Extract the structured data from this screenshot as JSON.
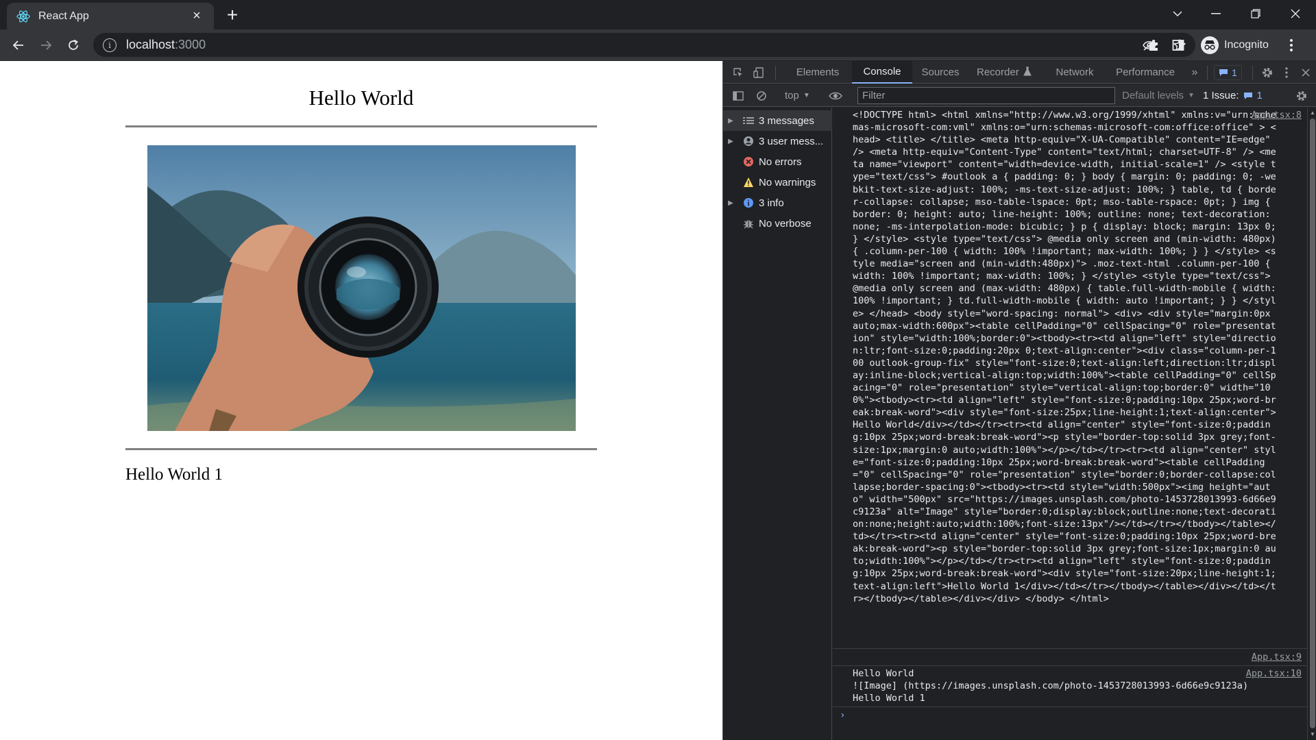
{
  "browser": {
    "tab_title": "React App",
    "url_host": "localhost",
    "url_port": ":3000",
    "profile_label": "Incognito"
  },
  "page": {
    "heading": "Hello World",
    "image_alt": "Image",
    "subheading": "Hello World 1"
  },
  "devtools": {
    "tabs": [
      "Elements",
      "Console",
      "Sources",
      "Recorder",
      "Network",
      "Performance"
    ],
    "active_tab": "Console",
    "messages_badge": "1",
    "context": "top",
    "filter_placeholder": "Filter",
    "levels": "Default levels",
    "issues_label": "1 Issue:",
    "issues_count": "1",
    "sidebar": [
      {
        "label": "3 messages",
        "icon": "list-icon"
      },
      {
        "label": "3 user mess...",
        "icon": "user-icon"
      },
      {
        "label": "No errors",
        "icon": "error-icon"
      },
      {
        "label": "No warnings",
        "icon": "warning-icon"
      },
      {
        "label": "3 info",
        "icon": "info-icon"
      },
      {
        "label": "No verbose",
        "icon": "verbose-icon"
      }
    ],
    "logs": [
      {
        "source": "App.tsx:8",
        "text": "<!DOCTYPE html> <html xmlns=\"http://www.w3.org/1999/xhtml\" xmlns:v=\"urn:schemas-microsoft-com:vml\" xmlns:o=\"urn:schemas-microsoft-com:office:office\" > <head> <title> </title> <meta http-equiv=\"X-UA-Compatible\" content=\"IE=edge\" /> <meta http-equiv=\"Content-Type\" content=\"text/html; charset=UTF-8\" /> <meta name=\"viewport\" content=\"width=device-width, initial-scale=1\" /> <style type=\"text/css\"> #outlook a { padding: 0; } body { margin: 0; padding: 0; -webkit-text-size-adjust: 100%; -ms-text-size-adjust: 100%; } table, td { border-collapse: collapse; mso-table-lspace: 0pt; mso-table-rspace: 0pt; } img { border: 0; height: auto; line-height: 100%; outline: none; text-decoration: none; -ms-interpolation-mode: bicubic; } p { display: block; margin: 13px 0; } </style> <style type=\"text/css\"> @media only screen and (min-width: 480px) { .column-per-100 { width: 100% !important; max-width: 100%; } } </style> <style media=\"screen and (min-width:480px)\"> .moz-text-html .column-per-100 { width: 100% !important; max-width: 100%; } </style> <style type=\"text/css\"> @media only screen and (max-width: 480px) { table.full-width-mobile { width: 100% !important; } td.full-width-mobile { width: auto !important; } } </style> </head> <body style=\"word-spacing: normal\"> <div> <div style=\"margin:0px auto;max-width:600px\"><table cellPadding=\"0\" cellSpacing=\"0\" role=\"presentation\" style=\"width:100%;border:0\"><tbody><tr><td align=\"left\" style=\"direction:ltr;font-size:0;padding:20px 0;text-align:center\"><div class=\"column-per-100 outlook-group-fix\" style=\"font-size:0;text-align:left;direction:ltr;display:inline-block;vertical-align:top;width:100%\"><table cellPadding=\"0\" cellSpacing=\"0\" role=\"presentation\" style=\"vertical-align:top;border:0\" width=\"100%\"><tbody><tr><td align=\"left\" style=\"font-size:0;padding:10px 25px;word-break:break-word\"><div style=\"font-size:25px;line-height:1;text-align:center\">Hello World</div></td></tr><tr><td align=\"center\" style=\"font-size:0;padding:10px 25px;word-break:break-word\"><p style=\"border-top:solid 3px grey;font-size:1px;margin:0 auto;width:100%\"></p></td></tr><tr><td align=\"center\" style=\"font-size:0;padding:10px 25px;word-break:break-word\"><table cellPadding=\"0\" cellSpacing=\"0\" role=\"presentation\" style=\"border:0;border-collapse:collapse;border-spacing:0\"><tbody><tr><td style=\"width:500px\"><img height=\"auto\" width=\"500px\" src=\"https://images.unsplash.com/photo-1453728013993-6d66e9c9123a\" alt=\"Image\" style=\"border:0;display:block;outline:none;text-decoration:none;height:auto;width:100%;font-size:13px\"/></td></tr></tbody></table></td></tr><tr><td align=\"center\" style=\"font-size:0;padding:10px 25px;word-break:break-word\"><p style=\"border-top:solid 3px grey;font-size:1px;margin:0 auto;width:100%\"></p></td></tr><tr><td align=\"left\" style=\"font-size:0;padding:10px 25px;word-break:break-word\"><div style=\"font-size:20px;line-height:1;text-align:left\">Hello World 1</div></td></tr></tbody></table></div></td></tr></tbody></table></div></div> </body> </html>"
      },
      {
        "source": "App.tsx:9",
        "text": ""
      },
      {
        "source": "App.tsx:10",
        "text": "Hello World\n![Image] (https://images.unsplash.com/photo-1453728013993-6d66e9c9123a)\nHello World 1"
      }
    ]
  }
}
